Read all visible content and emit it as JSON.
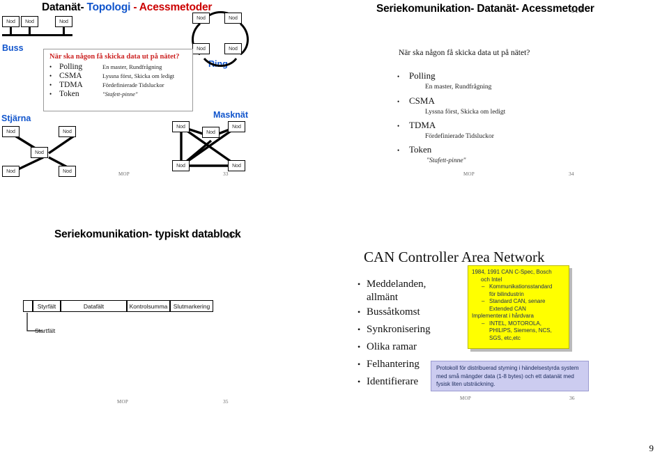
{
  "page": {
    "number": "9"
  },
  "slides": {
    "topology": {
      "title_part1": "Datanät-",
      "title_part2": "Topologi",
      "title_part3": "- Acessmetoder",
      "topologies": [
        {
          "label": "Buss",
          "nodes": [
            "Nod",
            "Nod",
            "Nod"
          ]
        },
        {
          "label": "Ring",
          "nodes": [
            "Nod",
            "Nod",
            "Nod",
            "Nod"
          ]
        },
        {
          "label": "Stjärna",
          "nodes": [
            "Nod",
            "Nod",
            "Nod",
            "Nod",
            "Nod"
          ]
        },
        {
          "label": "Masknät",
          "nodes": [
            "Nod",
            "Nod",
            "Nod",
            "Nod",
            "Nod"
          ]
        }
      ],
      "overlay": {
        "heading": "När ska någon få skicka data ut på nätet?",
        "bullet_char": "•",
        "rows": [
          {
            "term": "Polling",
            "desc": "En master, Rundfrågning"
          },
          {
            "term": "CSMA",
            "desc": "Lyssna först, Skicka om ledigt"
          },
          {
            "term": "TDMA",
            "desc": "Fördefinierade Tidsluckor"
          },
          {
            "term": "Token",
            "desc": "\"Stafett-pinne\""
          }
        ]
      },
      "footer": {
        "mop": "MOP",
        "number": "33"
      }
    },
    "access": {
      "title": "Seriekomunikation- Datanät- Acessmetoder",
      "ref": "s16",
      "question": "När ska någon få skicka data ut på nätet?",
      "bullet_char": "•",
      "items": [
        {
          "term": "Polling",
          "sub": "En master, Rundfrågning"
        },
        {
          "term": "CSMA",
          "sub": "Lyssna först, Skicka om ledigt"
        },
        {
          "term": "TDMA",
          "sub": "Fördefinierade Tidsluckor"
        },
        {
          "term": "Token",
          "sub": "\"Stafett-pinne\""
        }
      ],
      "footer": {
        "mop": "MOP",
        "number": "34"
      }
    },
    "datablock": {
      "title": "Seriekomunikation- typiskt datablock",
      "ref": "s17",
      "fields": [
        "",
        "Styrfält",
        "Datafält",
        "Kontrolsumma",
        "Slutmarkering"
      ],
      "callout": "Startfält",
      "footer": {
        "mop": "MOP",
        "number": "35"
      }
    },
    "can": {
      "title": "CAN Controller Area Network",
      "bullet_char": "•",
      "bullets": [
        {
          "line1": "Meddelanden,",
          "line2": "allmänt"
        },
        {
          "line1": "Bussåtkomst"
        },
        {
          "line1": "Synkronisering"
        },
        {
          "line1": "Olika ramar"
        },
        {
          "line1": "Felhantering"
        },
        {
          "line1": "Identifierare"
        }
      ],
      "yellow_box": {
        "line1": "1984, 1991 CAN C-Spec, Bosch",
        "line1_cont": "och Intel",
        "sub1_a": "Kommunikationsstandard",
        "sub1_b": "för bilindustrin",
        "sub2_a": "Standard CAN, senare",
        "sub2_b": "Extended CAN",
        "line2": "Implementerat i hårdvara",
        "sub3_a": "INTEL, MOTOROLA,",
        "sub3_b": "PHILIPS, Siemens, NCS,",
        "sub3_c": "SGS, etc,etc",
        "dash_char": "–",
        "color": "#ffff00"
      },
      "purple_box": {
        "text": "Protokoll för distribuerad styming i händelsestyrda system med små mängder data (1-8 bytes) och ett datanät med fysisk liten utsträckning.",
        "color": "#ccccf0"
      },
      "footer": {
        "mop": "MOP",
        "number": "36"
      }
    }
  }
}
